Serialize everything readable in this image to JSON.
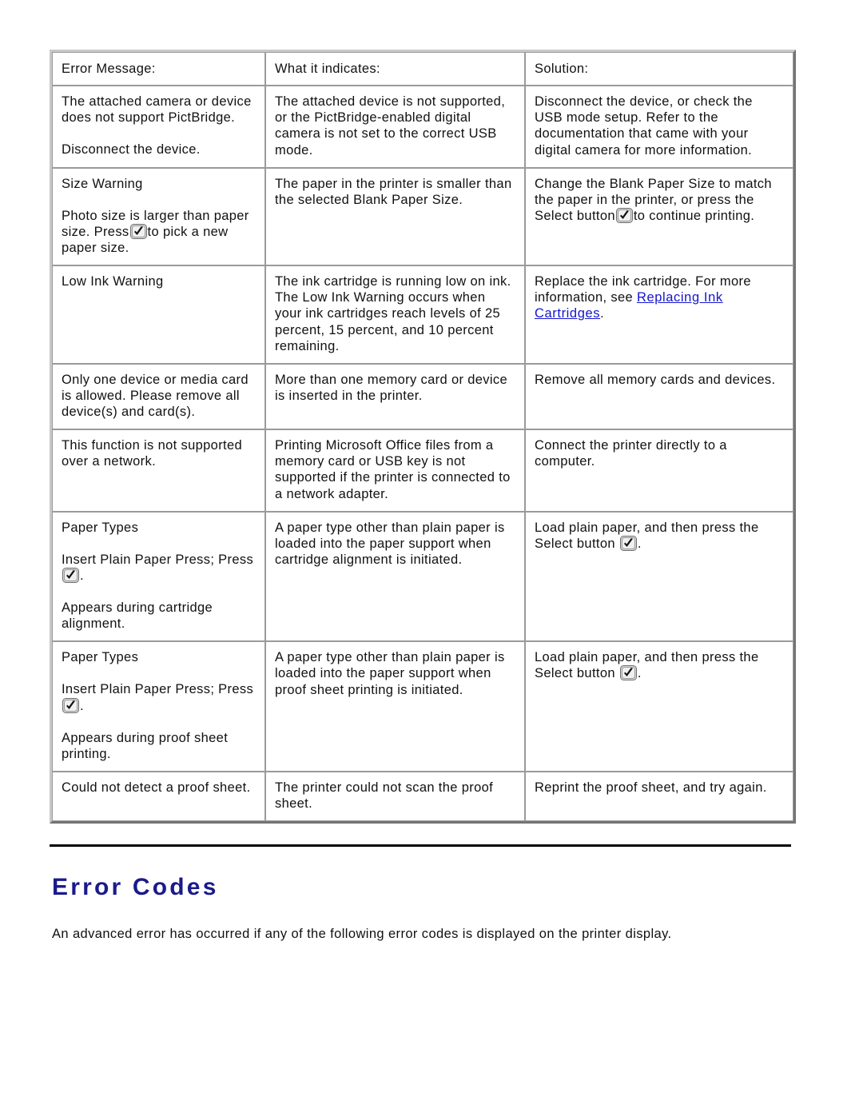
{
  "icons": {
    "select_button": "select-button-check-icon"
  },
  "colors": {
    "heading": "#1a1a8c",
    "link": "#1414cf",
    "table_border": "#9a9a9a",
    "rule": "#000000"
  },
  "table": {
    "headers": {
      "col1": "Error Message:",
      "col2": "What it indicates:",
      "col3": "Solution:"
    },
    "rows": [
      {
        "error_message_p1": "The attached camera or device does not support PictBridge.",
        "error_message_p2": "Disconnect the device.",
        "indicates": "The attached device is not supported, or the PictBridge-enabled digital camera is not set to the correct USB mode.",
        "solution": "Disconnect the device, or check the USB mode setup. Refer to the documentation that came with your digital camera for more information."
      },
      {
        "error_message_p1": "Size Warning",
        "error_message_p2_a": "Photo size is larger than paper size. Press",
        "error_message_p2_b": "to pick a new paper size.",
        "indicates": "The paper in the printer is smaller than the selected Blank Paper Size.",
        "solution_a": "Change the Blank Paper Size to match the paper in the printer, or press the Select button",
        "solution_b": "to continue printing."
      },
      {
        "error_message_p1": "Low Ink Warning",
        "indicates": "The ink cartridge is running low on ink. The Low Ink Warning occurs when your ink cartridges reach levels of 25 percent, 15 percent, and 10 percent remaining.",
        "solution_a": "Replace the ink cartridge. For more information, see",
        "solution_link": "Replacing Ink Cartridges",
        "solution_b": "."
      },
      {
        "error_message_p1": "Only one device or media card is allowed. Please remove all device(s) and card(s).",
        "indicates": "More than one memory card or device is inserted in the printer.",
        "solution": "Remove all memory cards and devices."
      },
      {
        "error_message_p1": "This function is not supported over a network.",
        "indicates": "Printing Microsoft Office files from a memory card or USB key is not supported if the printer is connected to a network adapter.",
        "solution": "Connect the printer directly to a computer."
      },
      {
        "error_message_p1": "Paper Types",
        "error_message_p2_a": "Insert Plain Paper Press; Press",
        "error_message_p2_b": ".",
        "error_message_p3": "Appears during cartridge alignment.",
        "indicates": "A paper type other than plain paper is loaded into the paper support when cartridge alignment is initiated.",
        "solution_a": "Load plain paper, and then press the Select button",
        "solution_b": "."
      },
      {
        "error_message_p1": "Paper Types",
        "error_message_p2_a": "Insert Plain Paper Press; Press",
        "error_message_p2_b": ".",
        "error_message_p3": "Appears during proof sheet printing.",
        "indicates": "A paper type other than plain paper is loaded into the paper support when proof sheet printing is initiated.",
        "solution_a": "Load plain paper, and then press the Select button",
        "solution_b": "."
      },
      {
        "error_message_p1": "Could not detect a proof sheet.",
        "indicates": "The printer could not scan the proof sheet.",
        "solution": "Reprint the proof sheet, and try again."
      }
    ]
  },
  "section": {
    "title": "Error Codes",
    "body": "An advanced error has occurred if any of the following error codes is displayed on the printer display."
  }
}
